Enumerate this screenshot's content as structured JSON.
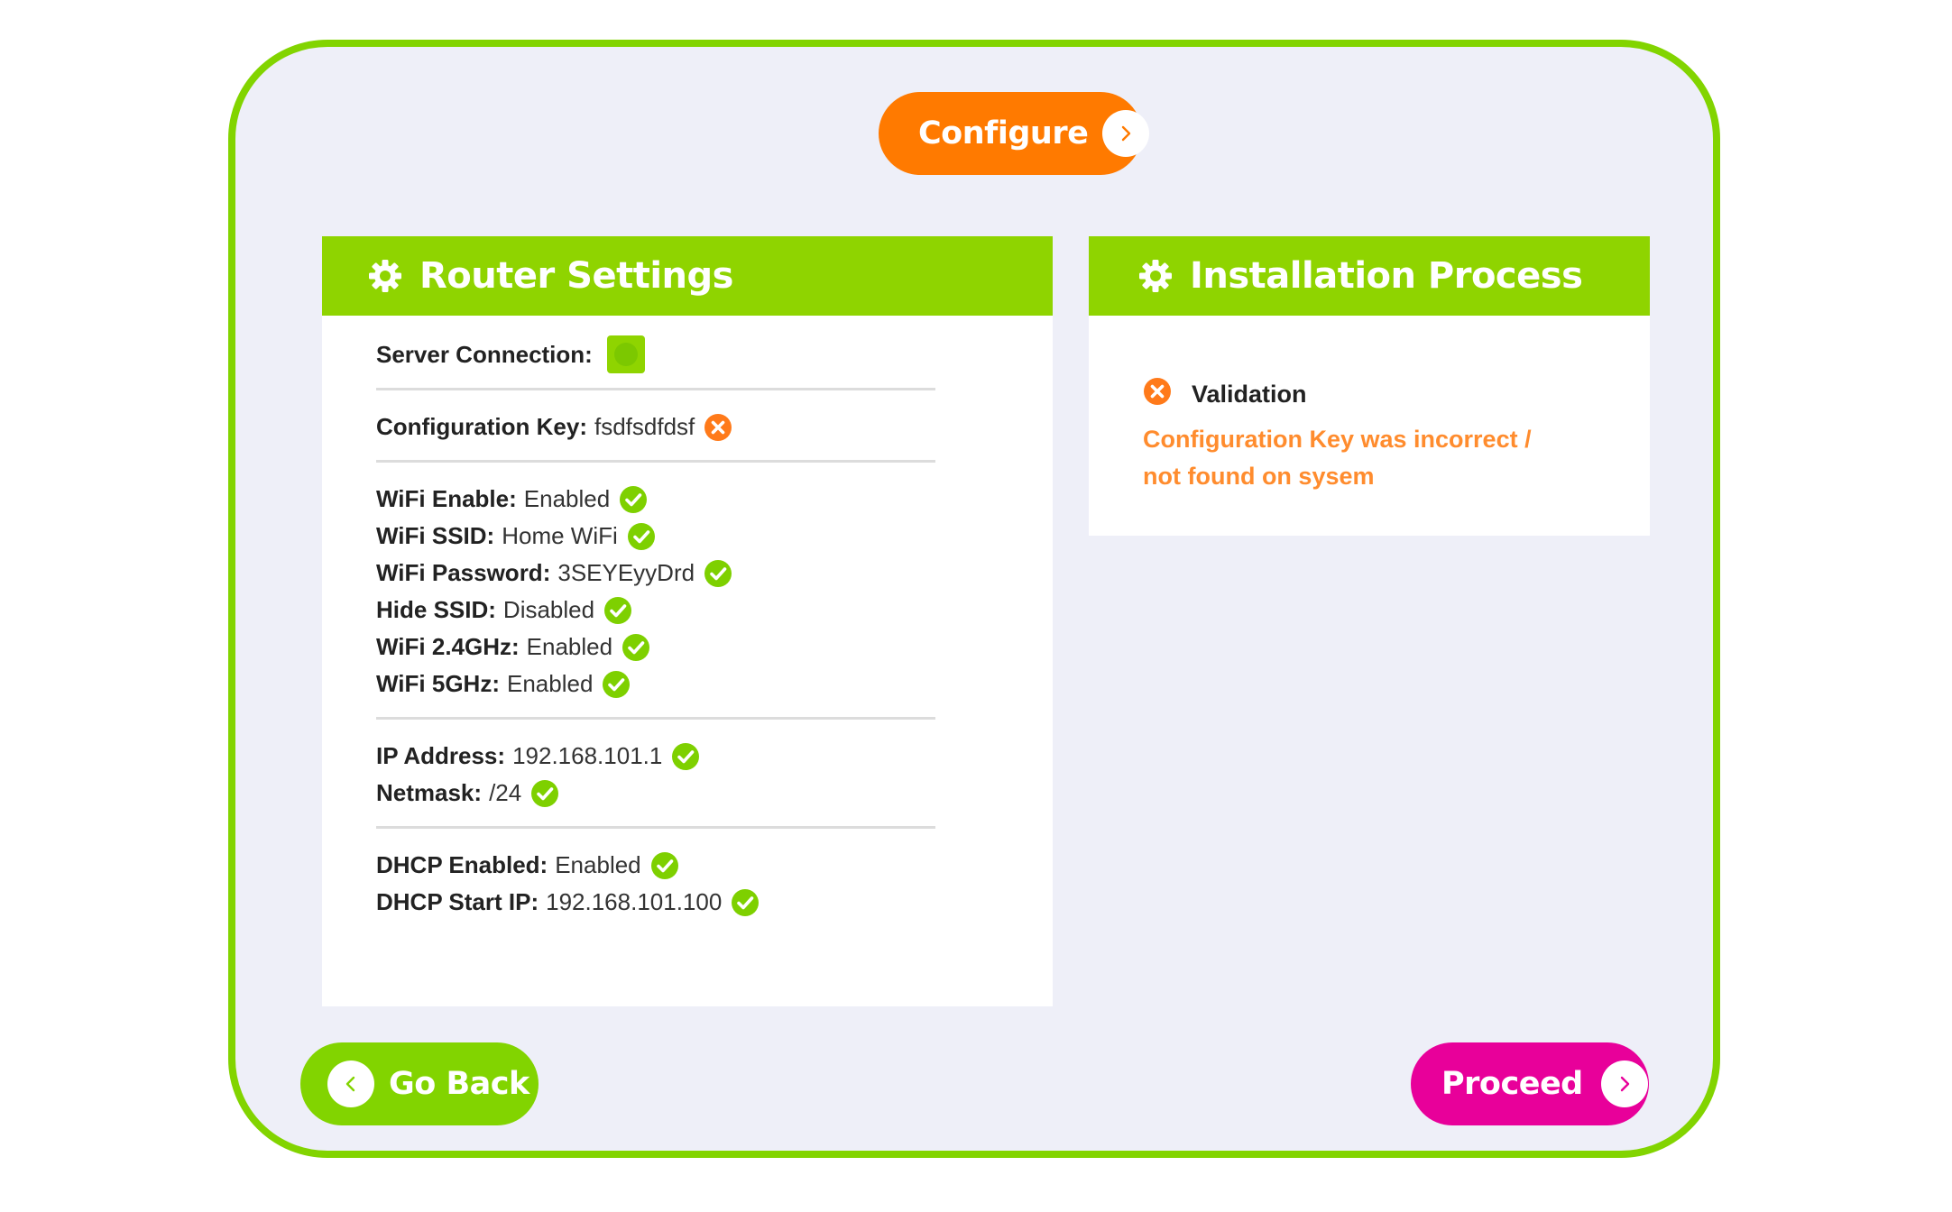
{
  "buttons": {
    "configure": "Configure",
    "go_back": "Go Back",
    "proceed": "Proceed"
  },
  "router_panel": {
    "title": "Router Settings",
    "server_connection": {
      "label": "Server Connection:",
      "status": "connected"
    },
    "config_key": {
      "label": "Configuration Key:",
      "value": "fsdfsdfdsf",
      "status": "error"
    },
    "wifi": [
      {
        "label": "WiFi Enable:",
        "value": "Enabled",
        "status": "ok"
      },
      {
        "label": "WiFi SSID:",
        "value": "Home WiFi",
        "status": "ok"
      },
      {
        "label": "WiFi Password:",
        "value": "3SEYEyyDrd",
        "status": "ok"
      },
      {
        "label": "Hide SSID:",
        "value": "Disabled",
        "status": "ok"
      },
      {
        "label": "WiFi 2.4GHz:",
        "value": "Enabled",
        "status": "ok"
      },
      {
        "label": "WiFi 5GHz:",
        "value": "Enabled",
        "status": "ok"
      }
    ],
    "network": [
      {
        "label": "IP Address:",
        "value": "192.168.101.1",
        "status": "ok"
      },
      {
        "label": "Netmask:",
        "value": "/24",
        "status": "ok"
      }
    ],
    "dhcp": [
      {
        "label": "DHCP Enabled:",
        "value": "Enabled",
        "status": "ok"
      },
      {
        "label": "DHCP Start IP:",
        "value": "192.168.101.100",
        "status": "ok"
      }
    ]
  },
  "install_panel": {
    "title": "Installation Process",
    "step": "Validation",
    "message_line1": "Configuration Key was incorrect /",
    "message_line2": "not found on sysem"
  },
  "colors": {
    "green": "#82d400",
    "orange": "#ff7a00",
    "magenta": "#e8009a",
    "error_text": "#ff8c2e",
    "background": "#eeeff8"
  },
  "icons": {
    "ok": "check-circle-icon",
    "error": "x-circle-icon",
    "header": "gear-icon",
    "next": "chevron-right-icon",
    "back": "chevron-left-icon"
  }
}
